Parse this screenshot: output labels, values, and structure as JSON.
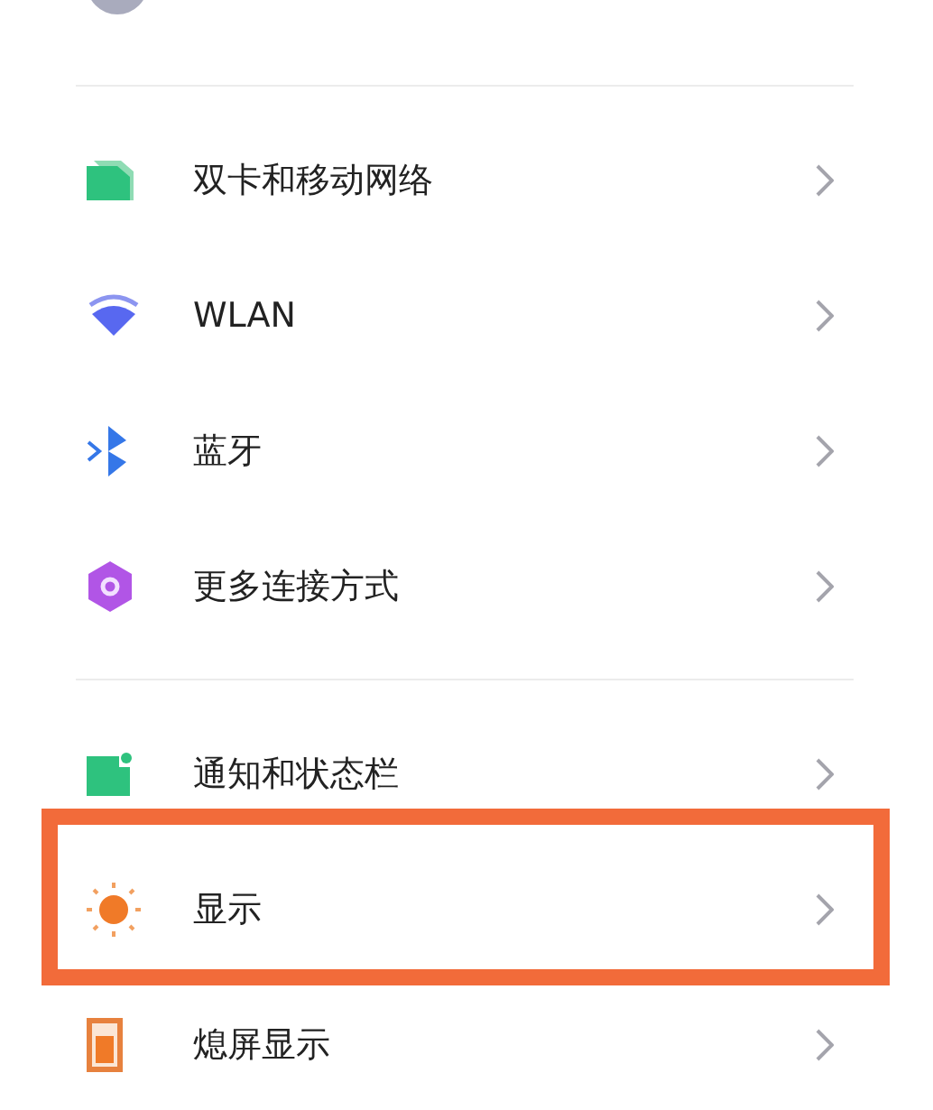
{
  "sections": [
    {
      "items": [
        {
          "kind": "sim",
          "label": "双卡和移动网络",
          "highlighted": false
        },
        {
          "kind": "wifi",
          "label": "WLAN",
          "highlighted": false
        },
        {
          "kind": "bluetooth",
          "label": "蓝牙",
          "highlighted": false
        },
        {
          "kind": "connect",
          "label": "更多连接方式",
          "highlighted": false
        }
      ]
    },
    {
      "items": [
        {
          "kind": "notify",
          "label": "通知和状态栏",
          "highlighted": false
        },
        {
          "kind": "sun",
          "label": "显示",
          "highlighted": true
        },
        {
          "kind": "aod",
          "label": "熄屏显示",
          "highlighted": false
        }
      ]
    }
  ]
}
